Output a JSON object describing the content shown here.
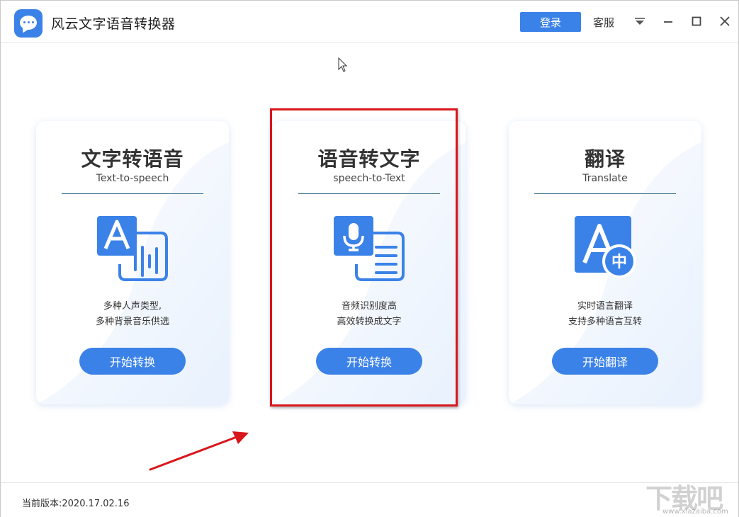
{
  "app": {
    "title": "风云文字语音转换器",
    "logo_icon": "chat-bubble-icon"
  },
  "titlebar": {
    "login_label": "登录",
    "service_label": "客服",
    "controls": [
      "dropdown-menu-icon",
      "minimize-icon",
      "maximize-icon",
      "close-icon"
    ]
  },
  "cards": [
    {
      "title": "文字转语音",
      "subtitle": "Text-to-speech",
      "icon": "text-to-speech-icon",
      "desc_line1": "多种人声类型,",
      "desc_line2": "多种背景音乐供选",
      "button": "开始转换"
    },
    {
      "title": "语音转文字",
      "subtitle": "speech-to-Text",
      "icon": "speech-to-text-icon",
      "desc_line1": "音频识别度高",
      "desc_line2": "高效转换成文字",
      "button": "开始转换"
    },
    {
      "title": "翻译",
      "subtitle": "Translate",
      "icon": "translate-icon",
      "icon_glyph": "中",
      "desc_line1": "实时语言翻译",
      "desc_line2": "支持多种语言互转",
      "button": "开始翻译"
    }
  ],
  "footer": {
    "version_label": "当前版本:",
    "version_value": "2020.17.02.16"
  },
  "watermark": {
    "text": "下载吧",
    "url": "www.xiazaiba.com"
  },
  "colors": {
    "accent": "#3b82e8",
    "annotation_red": "#d9161b"
  }
}
